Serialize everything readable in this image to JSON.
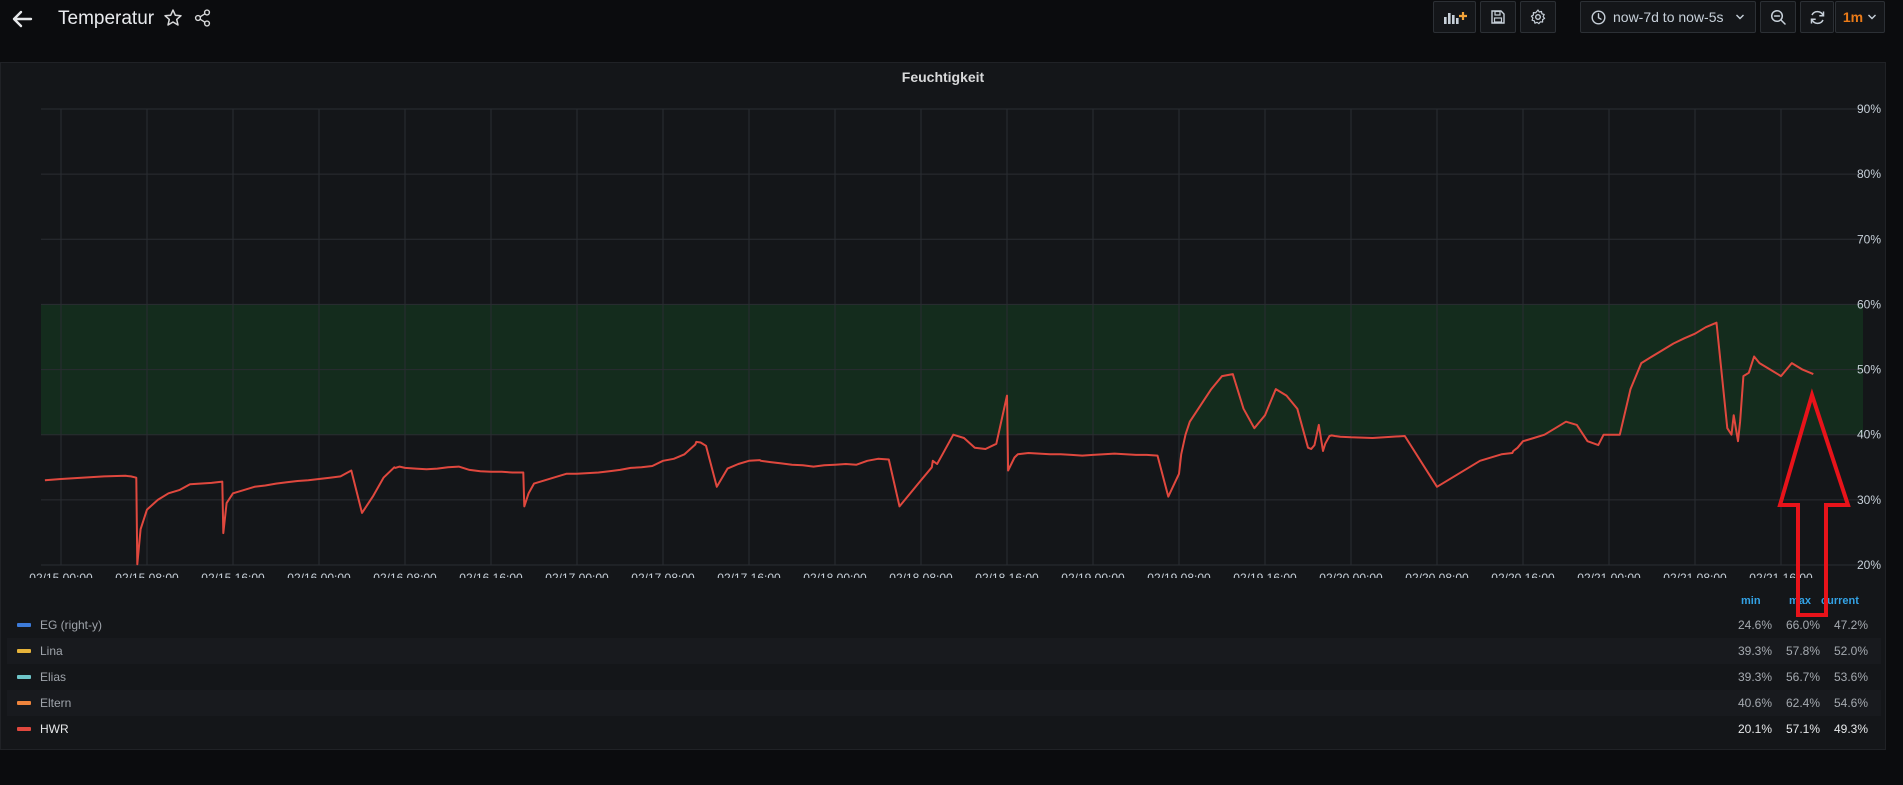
{
  "header": {
    "title": "Temperatur",
    "time_range": "now-7d to now-5s",
    "refresh_interval": "1m",
    "icons": [
      "arrow-left-icon",
      "star-icon",
      "share-icon",
      "add-panel-icon",
      "save-icon",
      "gear-icon",
      "clock-icon",
      "chevron-down-icon",
      "zoom-out-icon",
      "refresh-icon"
    ],
    "accent_color": "#eb7b18"
  },
  "panel": {
    "title": "Feuchtigkeit"
  },
  "chart_data": {
    "type": "line",
    "title": "Feuchtigkeit",
    "x_ticks": [
      "02/15 00:00",
      "02/15 08:00",
      "02/15 16:00",
      "02/16 00:00",
      "02/16 08:00",
      "02/16 16:00",
      "02/17 00:00",
      "02/17 08:00",
      "02/17 16:00",
      "02/18 00:00",
      "02/18 08:00",
      "02/18 16:00",
      "02/19 00:00",
      "02/19 08:00",
      "02/19 16:00",
      "02/20 00:00",
      "02/20 08:00",
      "02/20 16:00",
      "02/21 00:00",
      "02/21 08:00",
      "02/21 16:00"
    ],
    "y_ticks": [
      "20%",
      "30%",
      "40%",
      "50%",
      "60%",
      "70%",
      "80%",
      "90%"
    ],
    "ylim": [
      20,
      90
    ],
    "y_unit": "%",
    "y_axis_side": "right",
    "grid": true,
    "threshold_band": {
      "from": 40,
      "to": 60,
      "color": "#142c1d"
    },
    "x_unit": "hours since 02/15 00:00",
    "series": [
      {
        "name": "HWR",
        "color": "#e0483e",
        "x": [
          -1.5,
          0,
          4,
          6,
          6.5,
          7,
          7.1,
          7.4,
          8,
          9,
          10,
          11,
          12,
          14,
          15,
          15.1,
          15.4,
          16,
          17,
          18,
          19,
          20,
          21,
          22,
          23,
          24,
          25,
          26,
          27,
          28,
          29,
          30,
          31,
          31.1,
          31.5,
          32,
          33,
          34,
          35,
          36,
          37,
          38,
          39,
          40,
          41,
          42,
          43,
          43.1,
          43.5,
          44,
          45,
          46,
          47,
          48,
          49,
          50,
          51,
          52,
          53,
          54,
          55,
          56,
          57,
          58,
          59,
          59.1,
          59.5,
          60,
          61,
          62,
          63,
          64,
          65,
          65.1,
          65.5,
          66,
          67,
          68,
          69,
          70,
          71,
          72,
          73,
          74,
          75,
          76,
          77,
          78,
          79,
          80,
          81,
          81.1,
          81.5,
          82,
          83,
          84,
          85,
          86,
          87,
          88,
          88.1,
          88.7,
          89,
          90,
          91,
          92,
          93,
          94,
          95,
          96,
          97,
          98,
          99,
          100,
          101,
          102,
          103,
          104,
          104.2,
          104.6,
          105,
          106,
          107,
          108,
          109,
          110,
          111,
          112,
          113,
          114,
          115,
          116,
          116.3,
          116.6,
          117,
          117.4,
          117.6,
          118,
          118.2,
          118.5,
          119,
          120,
          122,
          125,
          128,
          130,
          132,
          134,
          135,
          135.1,
          135.5,
          136,
          137,
          138,
          139,
          140,
          141,
          142,
          143,
          143.5,
          144,
          145,
          146,
          147,
          148,
          149,
          150,
          151,
          152,
          153,
          154,
          155,
          155.4,
          155.6,
          156,
          156.2,
          156.5,
          157,
          157.5,
          158,
          159,
          160,
          161,
          162,
          163
        ],
        "values": [
          33,
          33.2,
          33.6,
          33.7,
          33.6,
          33.4,
          20.1,
          25.5,
          28.5,
          30,
          31,
          31.5,
          32.4,
          32.6,
          32.8,
          24.9,
          29.5,
          31,
          31.5,
          32,
          32.2,
          32.5,
          32.7,
          32.9,
          33,
          33.2,
          33.4,
          33.6,
          34.5,
          28,
          30.5,
          33.4,
          35,
          34.9,
          35.1,
          34.9,
          34.8,
          34.7,
          34.8,
          35,
          35.1,
          34.6,
          34.4,
          34.3,
          34.3,
          34.2,
          34.2,
          29,
          31,
          32.5,
          33,
          33.5,
          34,
          34,
          34.1,
          34.2,
          34.4,
          34.6,
          34.9,
          35,
          35.2,
          36,
          36.3,
          37,
          38.5,
          38.9,
          38.8,
          38.3,
          32,
          34.8,
          35.5,
          36,
          36.1,
          36,
          35.9,
          35.8,
          35.6,
          35.4,
          35.3,
          35.1,
          35.3,
          35.4,
          35.5,
          35.4,
          36,
          36.3,
          36.2,
          29,
          31,
          33,
          35,
          36,
          35.5,
          37,
          40,
          39.5,
          38,
          37.8,
          38.6,
          46,
          34.5,
          36.5,
          37,
          37.2,
          37.1,
          37,
          37,
          36.9,
          36.8,
          36.9,
          37,
          37.1,
          37,
          36.9,
          36.9,
          36.8,
          30.5,
          34,
          37,
          40,
          42,
          44.5,
          47,
          49,
          49.3,
          44,
          41,
          43,
          47,
          46,
          44,
          38,
          37.8,
          38.4,
          41.5,
          37.5,
          38.6,
          39.8,
          39.9,
          39.8,
          39.7,
          39.6,
          39.5,
          39.8,
          32,
          34,
          36,
          37,
          37.2,
          37.5,
          38,
          39,
          39.5,
          40,
          41,
          42,
          41.5,
          39,
          38.4,
          40,
          40,
          40,
          47,
          51,
          52,
          53,
          54,
          54.8,
          55.5,
          56.5,
          57.2,
          41,
          40,
          43,
          39,
          42,
          49,
          49.5,
          52,
          51,
          50,
          49,
          51,
          50,
          49.3
        ]
      }
    ],
    "legend": {
      "columns": [
        "min",
        "max",
        "current"
      ],
      "rows": [
        {
          "name": "EG (right-y)",
          "color": "#3d7bd9",
          "min": "24.6%",
          "max": "66.0%",
          "current": "47.2%",
          "active": false
        },
        {
          "name": "Lina",
          "color": "#e6b33a",
          "min": "39.3%",
          "max": "57.8%",
          "current": "52.0%",
          "active": false
        },
        {
          "name": "Elias",
          "color": "#6ec6c9",
          "min": "39.3%",
          "max": "56.7%",
          "current": "53.6%",
          "active": false
        },
        {
          "name": "Eltern",
          "color": "#ef843c",
          "min": "40.6%",
          "max": "62.4%",
          "current": "54.6%",
          "active": false
        },
        {
          "name": "HWR",
          "color": "#e0483e",
          "min": "20.1%",
          "max": "57.1%",
          "current": "49.3%",
          "active": true
        }
      ]
    }
  }
}
